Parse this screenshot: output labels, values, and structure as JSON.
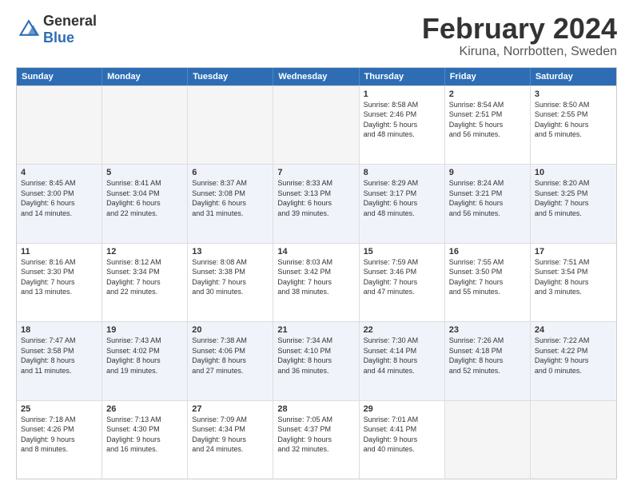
{
  "header": {
    "logo_general": "General",
    "logo_blue": "Blue",
    "main_title": "February 2024",
    "subtitle": "Kiruna, Norrbotten, Sweden"
  },
  "calendar": {
    "days": [
      "Sunday",
      "Monday",
      "Tuesday",
      "Wednesday",
      "Thursday",
      "Friday",
      "Saturday"
    ],
    "rows": [
      [
        {
          "day": "",
          "lines": []
        },
        {
          "day": "",
          "lines": []
        },
        {
          "day": "",
          "lines": []
        },
        {
          "day": "",
          "lines": []
        },
        {
          "day": "1",
          "lines": [
            "Sunrise: 8:58 AM",
            "Sunset: 2:46 PM",
            "Daylight: 5 hours",
            "and 48 minutes."
          ]
        },
        {
          "day": "2",
          "lines": [
            "Sunrise: 8:54 AM",
            "Sunset: 2:51 PM",
            "Daylight: 5 hours",
            "and 56 minutes."
          ]
        },
        {
          "day": "3",
          "lines": [
            "Sunrise: 8:50 AM",
            "Sunset: 2:55 PM",
            "Daylight: 6 hours",
            "and 5 minutes."
          ]
        }
      ],
      [
        {
          "day": "4",
          "lines": [
            "Sunrise: 8:45 AM",
            "Sunset: 3:00 PM",
            "Daylight: 6 hours",
            "and 14 minutes."
          ]
        },
        {
          "day": "5",
          "lines": [
            "Sunrise: 8:41 AM",
            "Sunset: 3:04 PM",
            "Daylight: 6 hours",
            "and 22 minutes."
          ]
        },
        {
          "day": "6",
          "lines": [
            "Sunrise: 8:37 AM",
            "Sunset: 3:08 PM",
            "Daylight: 6 hours",
            "and 31 minutes."
          ]
        },
        {
          "day": "7",
          "lines": [
            "Sunrise: 8:33 AM",
            "Sunset: 3:13 PM",
            "Daylight: 6 hours",
            "and 39 minutes."
          ]
        },
        {
          "day": "8",
          "lines": [
            "Sunrise: 8:29 AM",
            "Sunset: 3:17 PM",
            "Daylight: 6 hours",
            "and 48 minutes."
          ]
        },
        {
          "day": "9",
          "lines": [
            "Sunrise: 8:24 AM",
            "Sunset: 3:21 PM",
            "Daylight: 6 hours",
            "and 56 minutes."
          ]
        },
        {
          "day": "10",
          "lines": [
            "Sunrise: 8:20 AM",
            "Sunset: 3:25 PM",
            "Daylight: 7 hours",
            "and 5 minutes."
          ]
        }
      ],
      [
        {
          "day": "11",
          "lines": [
            "Sunrise: 8:16 AM",
            "Sunset: 3:30 PM",
            "Daylight: 7 hours",
            "and 13 minutes."
          ]
        },
        {
          "day": "12",
          "lines": [
            "Sunrise: 8:12 AM",
            "Sunset: 3:34 PM",
            "Daylight: 7 hours",
            "and 22 minutes."
          ]
        },
        {
          "day": "13",
          "lines": [
            "Sunrise: 8:08 AM",
            "Sunset: 3:38 PM",
            "Daylight: 7 hours",
            "and 30 minutes."
          ]
        },
        {
          "day": "14",
          "lines": [
            "Sunrise: 8:03 AM",
            "Sunset: 3:42 PM",
            "Daylight: 7 hours",
            "and 38 minutes."
          ]
        },
        {
          "day": "15",
          "lines": [
            "Sunrise: 7:59 AM",
            "Sunset: 3:46 PM",
            "Daylight: 7 hours",
            "and 47 minutes."
          ]
        },
        {
          "day": "16",
          "lines": [
            "Sunrise: 7:55 AM",
            "Sunset: 3:50 PM",
            "Daylight: 7 hours",
            "and 55 minutes."
          ]
        },
        {
          "day": "17",
          "lines": [
            "Sunrise: 7:51 AM",
            "Sunset: 3:54 PM",
            "Daylight: 8 hours",
            "and 3 minutes."
          ]
        }
      ],
      [
        {
          "day": "18",
          "lines": [
            "Sunrise: 7:47 AM",
            "Sunset: 3:58 PM",
            "Daylight: 8 hours",
            "and 11 minutes."
          ]
        },
        {
          "day": "19",
          "lines": [
            "Sunrise: 7:43 AM",
            "Sunset: 4:02 PM",
            "Daylight: 8 hours",
            "and 19 minutes."
          ]
        },
        {
          "day": "20",
          "lines": [
            "Sunrise: 7:38 AM",
            "Sunset: 4:06 PM",
            "Daylight: 8 hours",
            "and 27 minutes."
          ]
        },
        {
          "day": "21",
          "lines": [
            "Sunrise: 7:34 AM",
            "Sunset: 4:10 PM",
            "Daylight: 8 hours",
            "and 36 minutes."
          ]
        },
        {
          "day": "22",
          "lines": [
            "Sunrise: 7:30 AM",
            "Sunset: 4:14 PM",
            "Daylight: 8 hours",
            "and 44 minutes."
          ]
        },
        {
          "day": "23",
          "lines": [
            "Sunrise: 7:26 AM",
            "Sunset: 4:18 PM",
            "Daylight: 8 hours",
            "and 52 minutes."
          ]
        },
        {
          "day": "24",
          "lines": [
            "Sunrise: 7:22 AM",
            "Sunset: 4:22 PM",
            "Daylight: 9 hours",
            "and 0 minutes."
          ]
        }
      ],
      [
        {
          "day": "25",
          "lines": [
            "Sunrise: 7:18 AM",
            "Sunset: 4:26 PM",
            "Daylight: 9 hours",
            "and 8 minutes."
          ]
        },
        {
          "day": "26",
          "lines": [
            "Sunrise: 7:13 AM",
            "Sunset: 4:30 PM",
            "Daylight: 9 hours",
            "and 16 minutes."
          ]
        },
        {
          "day": "27",
          "lines": [
            "Sunrise: 7:09 AM",
            "Sunset: 4:34 PM",
            "Daylight: 9 hours",
            "and 24 minutes."
          ]
        },
        {
          "day": "28",
          "lines": [
            "Sunrise: 7:05 AM",
            "Sunset: 4:37 PM",
            "Daylight: 9 hours",
            "and 32 minutes."
          ]
        },
        {
          "day": "29",
          "lines": [
            "Sunrise: 7:01 AM",
            "Sunset: 4:41 PM",
            "Daylight: 9 hours",
            "and 40 minutes."
          ]
        },
        {
          "day": "",
          "lines": []
        },
        {
          "day": "",
          "lines": []
        }
      ]
    ]
  }
}
